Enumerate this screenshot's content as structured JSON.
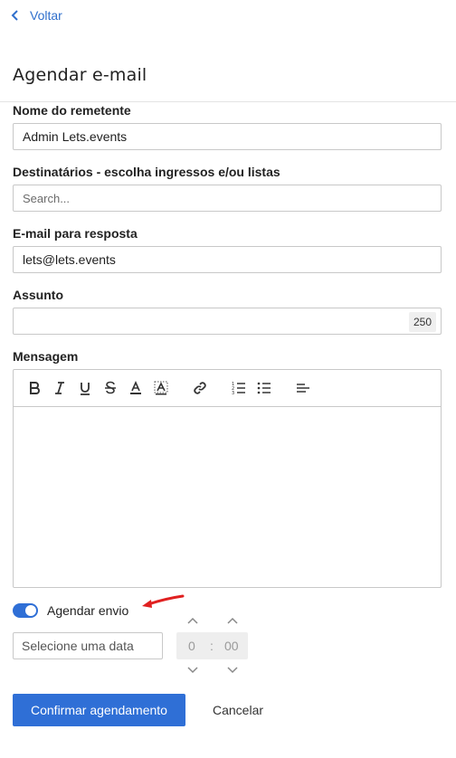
{
  "nav": {
    "back_label": "Voltar"
  },
  "page": {
    "title": "Agendar e-mail"
  },
  "form": {
    "sender": {
      "label": "Nome do remetente",
      "value": "Admin Lets.events"
    },
    "recipients": {
      "label": "Destinatários - escolha ingressos e/ou listas",
      "placeholder": "Search..."
    },
    "reply_to": {
      "label": "E-mail para resposta",
      "value": "lets@lets.events"
    },
    "subject": {
      "label": "Assunto",
      "value": "",
      "counter": "250"
    },
    "message": {
      "label": "Mensagem",
      "value": ""
    }
  },
  "toolbar": {
    "icons": [
      "bold-icon",
      "italic-icon",
      "underline-icon",
      "strikethrough-icon",
      "font-color-icon",
      "highlight-icon",
      "link-icon",
      "ordered-list-icon",
      "bullet-list-icon",
      "align-left-icon"
    ]
  },
  "schedule": {
    "toggle_label": "Agendar envio",
    "toggle_on": true,
    "date_placeholder": "Selecione uma data",
    "hour": "0",
    "separator": ":",
    "minute": "00"
  },
  "actions": {
    "confirm_label": "Confirmar agendamento",
    "cancel_label": "Cancelar"
  },
  "colors": {
    "accent": "#2f6fd6",
    "link": "#2f6fcc",
    "annotation_arrow": "#e02020"
  }
}
